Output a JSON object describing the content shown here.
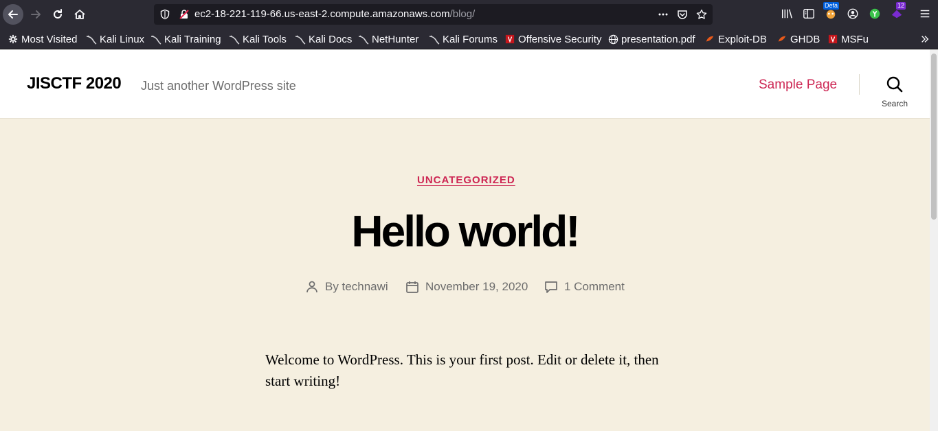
{
  "browser": {
    "url_host": "ec2-18-221-119-66.us-east-2.compute.amazonaws.com",
    "url_path": "/blog/",
    "badges": {
      "default": "Defa",
      "count": "12"
    }
  },
  "bookmarks": [
    {
      "label": "Most Visited",
      "icon": "gear-icon"
    },
    {
      "label": "Kali Linux",
      "icon": "kali-dragon-icon"
    },
    {
      "label": "Kali Training",
      "icon": "kali-dragon-icon"
    },
    {
      "label": "Kali Tools",
      "icon": "kali-dragon-icon"
    },
    {
      "label": "Kali Docs",
      "icon": "kali-dragon-icon"
    },
    {
      "label": "NetHunter",
      "icon": "kali-dragon-icon"
    },
    {
      "label": "Kali Forums",
      "icon": "kali-dragon-icon"
    },
    {
      "label": "Offensive Security",
      "icon": "offsec-icon"
    },
    {
      "label": "presentation.pdf",
      "icon": "globe-icon"
    },
    {
      "label": "Exploit-DB",
      "icon": "exploitdb-icon"
    },
    {
      "label": "GHDB",
      "icon": "exploitdb-icon"
    },
    {
      "label": "MSFu",
      "icon": "offsec-icon"
    }
  ],
  "site": {
    "title": "JISCTF 2020",
    "description": "Just another WordPress site",
    "menu_item": "Sample Page",
    "search_label": "Search"
  },
  "post": {
    "category": "UNCATEGORIZED",
    "title": "Hello world!",
    "author": "By technawi",
    "date": "November 19, 2020",
    "comments": "1 Comment",
    "body": "Welcome to WordPress. This is your first post. Edit or delete it, then start writing!"
  },
  "colors": {
    "accent": "#cd2653",
    "page_bg": "#f5efe0",
    "chrome_bg": "#2b2a33"
  }
}
